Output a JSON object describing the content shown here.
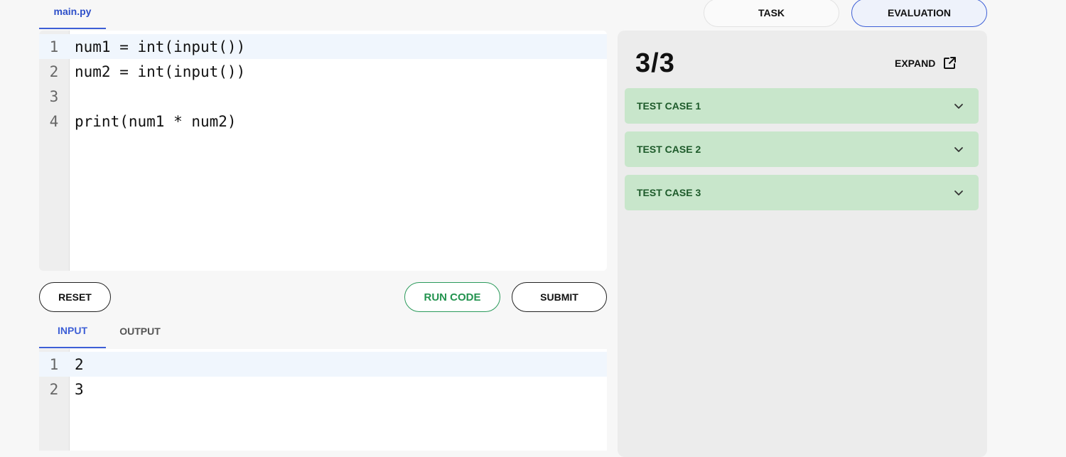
{
  "file_tab": {
    "label": "main.py"
  },
  "editor": {
    "lines": [
      {
        "num": "1",
        "code": "num1 = int(input())"
      },
      {
        "num": "2",
        "code": "num2 = int(input())"
      },
      {
        "num": "3",
        "code": ""
      },
      {
        "num": "4",
        "code": "print(num1 * num2)"
      }
    ]
  },
  "buttons": {
    "reset": "RESET",
    "run": "RUN CODE",
    "submit": "SUBMIT"
  },
  "io_tabs": {
    "input": "INPUT",
    "output": "OUTPUT"
  },
  "input_editor": {
    "lines": [
      {
        "num": "1",
        "text": "2"
      },
      {
        "num": "2",
        "text": "3"
      }
    ]
  },
  "top_tabs": {
    "task": "TASK",
    "evaluation": "EVALUATION"
  },
  "evaluation": {
    "score": "3/3",
    "expand_label": "EXPAND",
    "test_cases": [
      {
        "label": "TEST CASE 1"
      },
      {
        "label": "TEST CASE 2"
      },
      {
        "label": "TEST CASE 3"
      }
    ]
  },
  "colors": {
    "accent": "#3d5fd6",
    "run_green": "#23934f",
    "test_pass_bg": "#c8e6cb"
  },
  "icons": {
    "expand": "external-link-icon",
    "chevron": "chevron-down-icon"
  }
}
